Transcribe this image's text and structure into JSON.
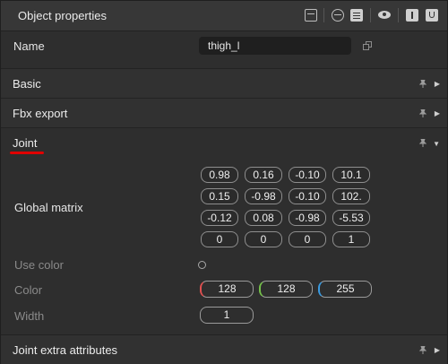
{
  "header": {
    "title": "Object properties",
    "icons": [
      "frame-icon",
      "split-view-icon",
      "list-icon",
      "eye-icon",
      "text-icon",
      "u-icon"
    ]
  },
  "name_row": {
    "label": "Name",
    "value": "thigh_l"
  },
  "sections": {
    "basic": "Basic",
    "fbx_export": "Fbx export",
    "joint": "Joint",
    "joint_extra": "Joint extra attributes"
  },
  "joint": {
    "global_matrix_label": "Global matrix",
    "matrix": [
      [
        "0.98",
        "0.16",
        "-0.10",
        "10.1"
      ],
      [
        "0.15",
        "-0.98",
        "-0.10",
        "102."
      ],
      [
        "-0.12",
        "0.08",
        "-0.98",
        "-5.53"
      ],
      [
        "0",
        "0",
        "0",
        "1"
      ]
    ],
    "use_color_label": "Use color",
    "color_label": "Color",
    "color": {
      "r": "128",
      "g": "128",
      "b": "255"
    },
    "channel_colors": {
      "r": "#e05050",
      "g": "#74c04a",
      "b": "#3a9ae0"
    },
    "width_label": "Width",
    "width": "1"
  },
  "accent": "#e00000"
}
